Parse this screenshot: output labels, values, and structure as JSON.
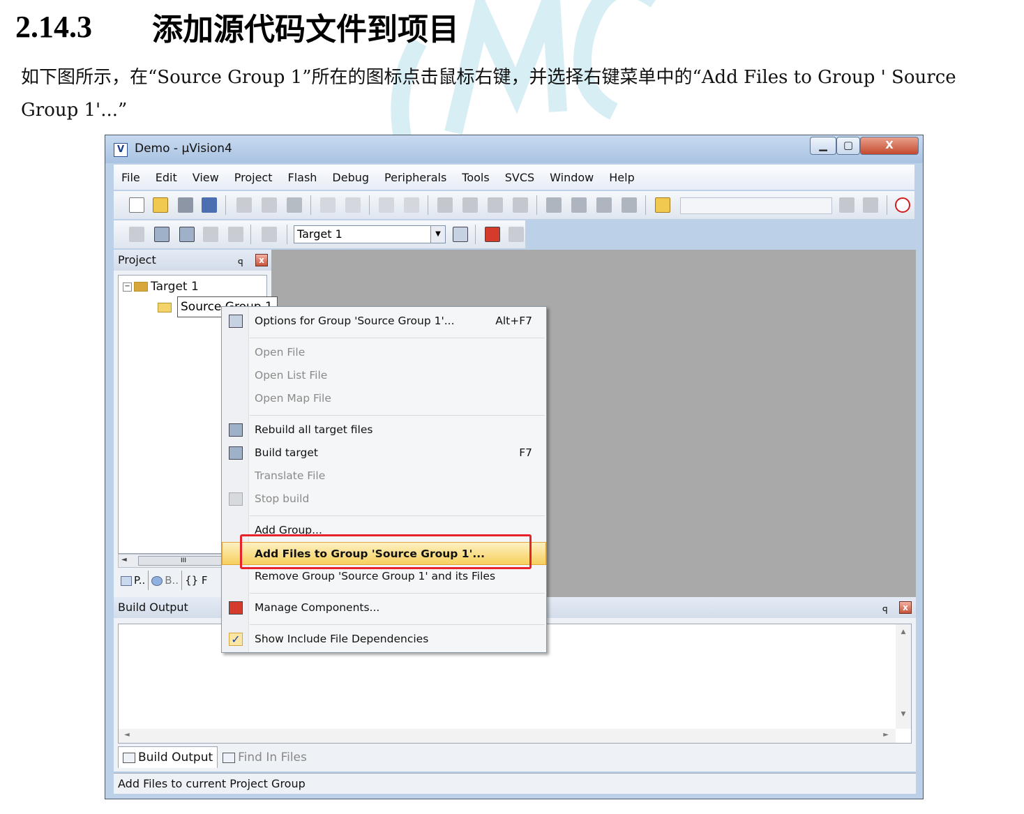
{
  "heading": {
    "number": "2.14.3",
    "title": "添加源代码文件到项目"
  },
  "paragraph": "如下图所示，在“Source Group 1”所在的图标点击鼠标右键，并选择右键菜单中的“Add Files to Group ' Source Group 1'...”",
  "window": {
    "title": "Demo  - µVision4",
    "controls": {
      "minimize": "▁",
      "maximize": "▢",
      "close": "X"
    },
    "menu": [
      "File",
      "Edit",
      "View",
      "Project",
      "Flash",
      "Debug",
      "Peripherals",
      "Tools",
      "SVCS",
      "Window",
      "Help"
    ],
    "toolbar2": {
      "target": "Target 1"
    },
    "project_pane": {
      "title": "Project",
      "pin": "ꟼ",
      "close": "x",
      "tree": {
        "root": "Target 1",
        "child": "Source Group 1"
      },
      "tabs": [
        "P..",
        "B..",
        "{} F"
      ]
    },
    "build_pane": {
      "title": "Build Output",
      "tabs": [
        "Build Output",
        "Find In Files"
      ]
    },
    "status": "Add Files to current Project Group"
  },
  "context_menu": {
    "items": [
      {
        "label": "Options for Group 'Source Group 1'...",
        "shortcut": "Alt+F7",
        "enabled": true,
        "icon": "options-wand-icon"
      },
      {
        "label": "Open File",
        "enabled": false
      },
      {
        "label": "Open List File",
        "enabled": false
      },
      {
        "label": "Open Map File",
        "enabled": false
      },
      {
        "label": "Rebuild all target files",
        "enabled": true,
        "icon": "rebuild-icon"
      },
      {
        "label": "Build target",
        "shortcut": "F7",
        "enabled": true,
        "icon": "build-icon"
      },
      {
        "label": "Translate File",
        "enabled": false
      },
      {
        "label": "Stop build",
        "enabled": false,
        "icon": "stop-build-icon"
      },
      {
        "label": "Add Group...",
        "enabled": true
      },
      {
        "label": "Add Files to Group 'Source Group 1'...",
        "enabled": true,
        "highlighted": true
      },
      {
        "label": "Remove Group 'Source Group 1' and its Files",
        "enabled": true
      },
      {
        "label": "Manage Components...",
        "enabled": true,
        "icon": "manage-components-icon"
      },
      {
        "label": "Show Include File Dependencies",
        "enabled": true,
        "checked": true,
        "icon": "checkmark-icon"
      }
    ],
    "check_glyph": "✓"
  },
  "colors": {
    "highlight_box": "#e8222a",
    "menu_highlight": "#f7cf5c",
    "workspace": "#a9a9a9",
    "watermark": "#cfeaf3"
  }
}
